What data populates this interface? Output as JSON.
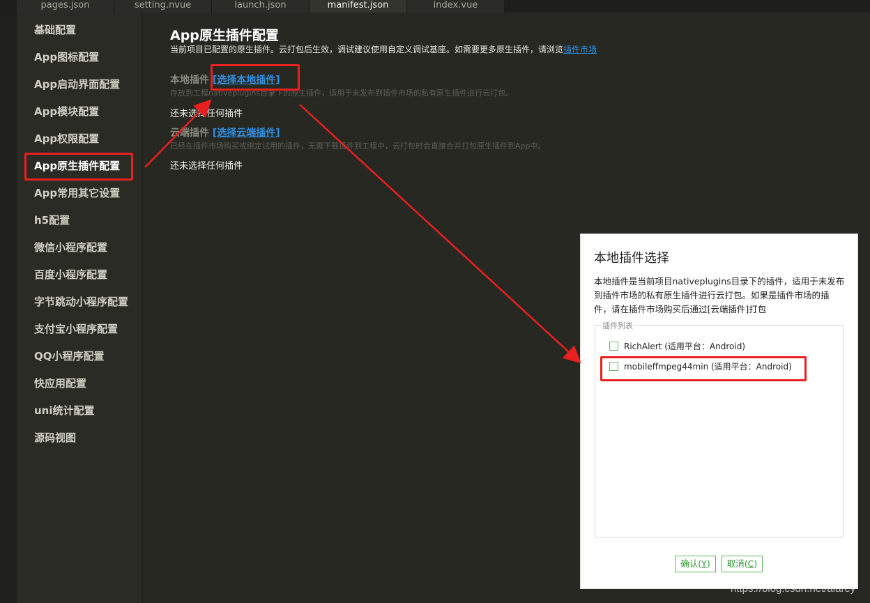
{
  "tabs": [
    {
      "label": "pages.json"
    },
    {
      "label": "setting.nvue"
    },
    {
      "label": "launch.json"
    },
    {
      "label": "manifest.json"
    },
    {
      "label": "index.vue"
    }
  ],
  "sidebar": {
    "items": [
      {
        "label": "基础配置"
      },
      {
        "label": "App图标配置"
      },
      {
        "label": "App启动界面配置"
      },
      {
        "label": "App模块配置"
      },
      {
        "label": "App权限配置"
      },
      {
        "label": "App原生插件配置"
      },
      {
        "label": "App常用其它设置"
      },
      {
        "label": "h5配置"
      },
      {
        "label": "微信小程序配置"
      },
      {
        "label": "百度小程序配置"
      },
      {
        "label": "字节跳动小程序配置"
      },
      {
        "label": "支付宝小程序配置"
      },
      {
        "label": "QQ小程序配置"
      },
      {
        "label": "快应用配置"
      },
      {
        "label": "uni统计配置"
      },
      {
        "label": "源码视图"
      }
    ]
  },
  "main": {
    "title": "App原生插件配置",
    "desc": "当前项目已配置的原生插件。云打包后生效，调试建议使用自定义调试基座。如需要更多原生插件，请浏览",
    "market_link": "插件市场",
    "local": {
      "heading": "本地插件",
      "open_bracket": "[",
      "link": "选择本地插件",
      "close_bracket": "]",
      "desc": "存放到工程nativeplugins目录下的原生插件，适用于未发布到插件市场的私有原生插件进行云打包。",
      "empty": "还未选择任何插件"
    },
    "cloud": {
      "heading": "云端插件",
      "open_bracket": "[",
      "link": "选择云端插件",
      "close_bracket": "]",
      "desc": "已经在插件市场购买或绑定试用的插件，无需下载插件到工程中，云打包时会直接合并打包原生插件到App中。",
      "empty": "还未选择任何插件"
    }
  },
  "dialog": {
    "title": "本地插件选择",
    "desc": "本地插件是当前项目nativeplugins目录下的插件，适用于未发布到插件市场的私有原生插件进行云打包。如果是插件市场的插件，请在插件市场购买后通过[云端插件]打包",
    "list_legend": "插件列表",
    "plugins": [
      {
        "label": "RichAlert (适用平台：Android)",
        "checked": false
      },
      {
        "label": "mobileffmpeg44min (适用平台：Android)",
        "checked": false
      }
    ],
    "confirm_label": "确认(",
    "confirm_key": "Y",
    "confirm_end": ")",
    "cancel_label": "取消(",
    "cancel_key": "C",
    "cancel_end": ")"
  },
  "watermark": "https://blog.csdn.net/alarey",
  "colors": {
    "editor_bg": "#272822",
    "highlight": "#e8201f",
    "link": "#2f8fe0",
    "button_green": "#2e9a2e"
  }
}
